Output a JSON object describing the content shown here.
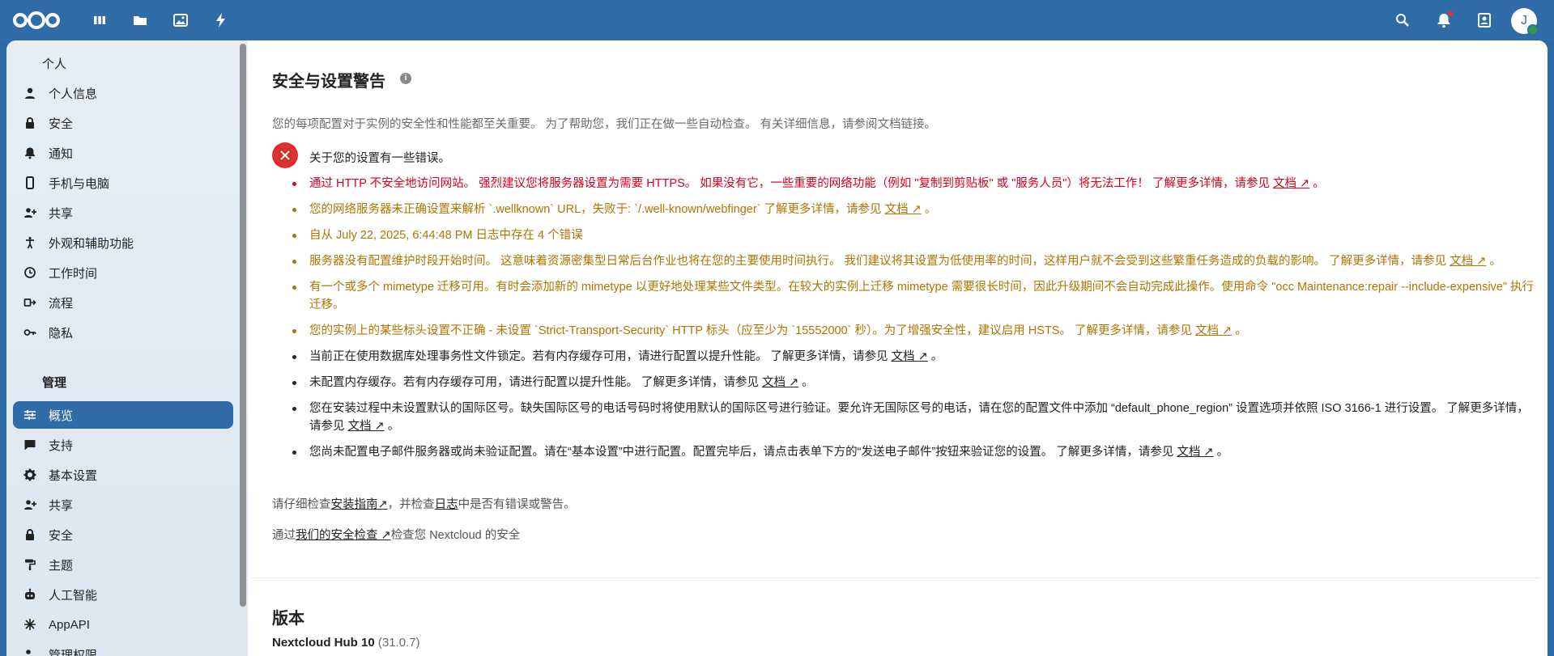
{
  "topbar": {
    "user_initial": "J"
  },
  "sidebar": {
    "personal_heading": "个人",
    "personal_items": [
      {
        "label": "个人信息",
        "icon": "person-icon"
      },
      {
        "label": "安全",
        "icon": "lock-icon"
      },
      {
        "label": "通知",
        "icon": "bell-icon"
      },
      {
        "label": "手机与电脑",
        "icon": "phone-icon"
      },
      {
        "label": "共享",
        "icon": "share-icon"
      },
      {
        "label": "外观和辅助功能",
        "icon": "accessibility-icon"
      },
      {
        "label": "工作时间",
        "icon": "clock-icon"
      },
      {
        "label": "流程",
        "icon": "flow-icon"
      },
      {
        "label": "隐私",
        "icon": "key-icon"
      }
    ],
    "admin_heading": "管理",
    "admin_items": [
      {
        "label": "概览",
        "icon": "sliders-icon",
        "active": true
      },
      {
        "label": "支持",
        "icon": "chat-icon"
      },
      {
        "label": "基本设置",
        "icon": "gear-icon"
      },
      {
        "label": "共享",
        "icon": "share-icon"
      },
      {
        "label": "安全",
        "icon": "lock-icon"
      },
      {
        "label": "主题",
        "icon": "paint-roller-icon"
      },
      {
        "label": "人工智能",
        "icon": "robot-icon"
      },
      {
        "label": "AppAPI",
        "icon": "api-icon"
      },
      {
        "label": "管理权限",
        "icon": "admin-icon"
      }
    ]
  },
  "main": {
    "title": "安全与设置警告",
    "info_glyph": "i",
    "description": "您的每项配置对于实例的安全性和性能都至关重要。 为了帮助您，我们正在做一些自动检查。 有关详细信息，请参阅文档链接。",
    "error_summary": "关于您的设置有一些错误。",
    "issues": [
      {
        "level": "err",
        "text": "通过 HTTP 不安全地访问网站。 强烈建议您将服务器设置为需要 HTTPS。 如果没有它，一些重要的网络功能（例如 \"复制到剪贴板\" 或 \"服务人员\"）将无法工作！ 了解更多详情，请参见 ",
        "link": "文档 ↗",
        "tail": " 。"
      },
      {
        "level": "warn",
        "text": "您的网络服务器未正确设置来解析 `.wellknown` URL，失败于: `/.well-known/webfinger` 了解更多详情，请参见 ",
        "link": "文档 ↗",
        "tail": " 。"
      },
      {
        "level": "warn",
        "text": "自从 July 22, 2025, 6:44:48 PM 日志中存在 4 个错误",
        "link": "",
        "tail": ""
      },
      {
        "level": "warn",
        "text": "服务器没有配置维护时段开始时间。 这意味着资源密集型日常后台作业也将在您的主要使用时间执行。 我们建议将其设置为低使用率的时间，这样用户就不会受到这些繁重任务造成的负载的影响。 了解更多详情，请参见 ",
        "link": "文档 ↗",
        "tail": " 。"
      },
      {
        "level": "warn",
        "text": "有一个或多个 mimetype 迁移可用。有时会添加新的 mimetype 以更好地处理某些文件类型。在较大的实例上迁移 mimetype 需要很长时间，因此升级期间不会自动完成此操作。使用命令 \"occ Maintenance:repair --include-expensive\" 执行迁移。",
        "link": "",
        "tail": ""
      },
      {
        "level": "warn",
        "text": "您的实例上的某些标头设置不正确 - 未设置 `Strict-Transport-Security` HTTP 标头（应至少为 `15552000` 秒）。为了增强安全性，建议启用 HSTS。 了解更多详情，请参见 ",
        "link": "文档 ↗",
        "tail": " 。"
      },
      {
        "level": "info",
        "text": "当前正在使用数据库处理事务性文件锁定。若有内存缓存可用，请进行配置以提升性能。 了解更多详情，请参见 ",
        "link": "文档 ↗",
        "tail": " 。"
      },
      {
        "level": "info",
        "text": "未配置内存缓存。若有内存缓存可用，请进行配置以提升性能。 了解更多详情，请参见 ",
        "link": "文档 ↗",
        "tail": " 。"
      },
      {
        "level": "info",
        "text": "您在安装过程中未设置默认的国际区号。缺失国际区号的电话号码时将使用默认的国际区号进行验证。要允许无国际区号的电话，请在您的配置文件中添加 “default_phone_region” 设置选项并依照 ISO 3166-1 进行设置。 了解更多详情，请参见 ",
        "link": "文档 ↗",
        "tail": " 。"
      },
      {
        "level": "info",
        "text": "您尚未配置电子邮件服务器或尚未验证配置。请在“基本设置”中进行配置。配置完毕后，请点击表单下方的“发送电子邮件”按钮来验证您的设置。 了解更多详情，请参见 ",
        "link": "文档 ↗",
        "tail": " 。"
      }
    ],
    "review": {
      "pre": "请仔细检查",
      "guide_link": "安装指南↗",
      "mid": "，并检查",
      "log_link": "日志",
      "post": "中是否有错误或警告。"
    },
    "security_scan": {
      "pre": "通过",
      "link": "我们的安全检查 ↗",
      "post": "检查您 Nextcloud 的安全"
    },
    "version_title": "版本",
    "version_name": "Nextcloud Hub 10",
    "version_number": "(31.0.7)"
  }
}
